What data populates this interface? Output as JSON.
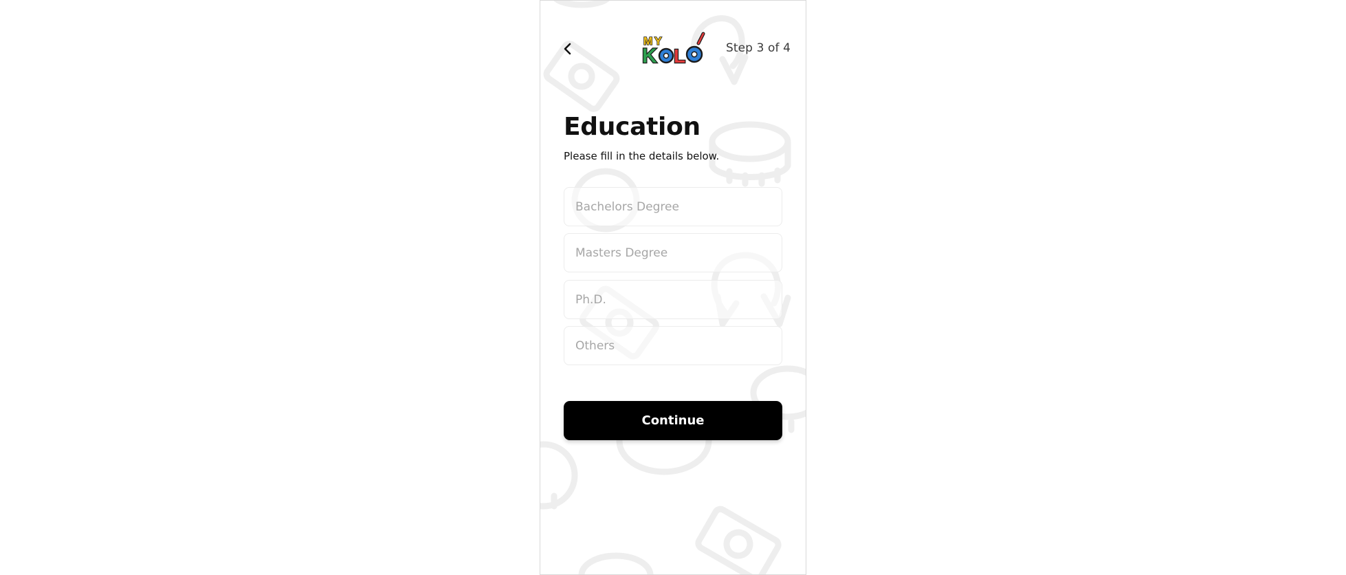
{
  "header": {
    "step_label": "Step 3 of 4",
    "logo_text_top": "MY",
    "logo_text_bottom": "KOLO"
  },
  "page": {
    "title": "Education",
    "subtitle": "Please fill in the details below."
  },
  "form": {
    "fields": [
      {
        "placeholder": "Bachelors Degree",
        "value": ""
      },
      {
        "placeholder": "Masters Degree",
        "value": ""
      },
      {
        "placeholder": "Ph.D.",
        "value": ""
      },
      {
        "placeholder": "Others",
        "value": ""
      }
    ],
    "submit_label": "Continue"
  },
  "icons": {
    "back": "chevron-left-icon",
    "background": "money-pattern"
  },
  "colors": {
    "primary_button": "#000000",
    "button_text": "#ffffff",
    "pattern": "#ececec",
    "logo_green": "#2e9e4f",
    "logo_red": "#e23b3b",
    "logo_blue": "#2f7fd6",
    "logo_yellow": "#f3c21b"
  }
}
